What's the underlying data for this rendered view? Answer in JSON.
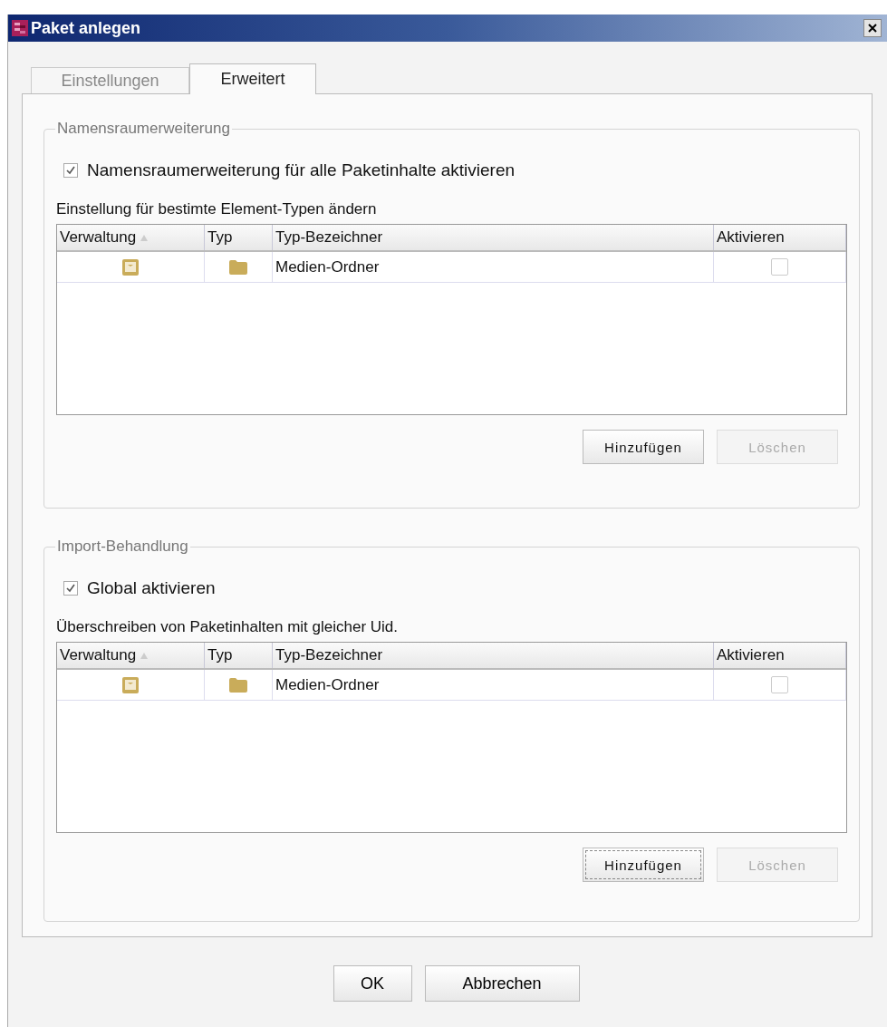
{
  "window": {
    "title": "Paket anlegen"
  },
  "tabs": [
    {
      "label": "Einstellungen",
      "selected": false
    },
    {
      "label": "Erweitert",
      "selected": true
    }
  ],
  "groups": [
    {
      "title": "Namensraumerweiterung",
      "checkbox": {
        "label": "Namensraumerweiterung für alle Paketinhalte aktivieren",
        "checked": true
      },
      "caption": "Einstellung für bestimte Element-Typen ändern",
      "table": {
        "columns": [
          "Verwaltung",
          "Typ",
          "Typ-Bezeichner",
          "Aktivieren"
        ],
        "rows": [
          {
            "type_label": "Medien-Ordner",
            "checked": false
          }
        ]
      },
      "buttons": [
        {
          "label": "Hinzufügen",
          "disabled": false,
          "focused": false
        },
        {
          "label": "Löschen",
          "disabled": true,
          "focused": false
        }
      ]
    },
    {
      "title": "Import-Behandlung",
      "checkbox": {
        "label": "Global aktivieren",
        "checked": true
      },
      "caption": "Überschreiben von Paketinhalten mit gleicher Uid.",
      "table": {
        "columns": [
          "Verwaltung",
          "Typ",
          "Typ-Bezeichner",
          "Aktivieren"
        ],
        "rows": [
          {
            "type_label": "Medien-Ordner",
            "checked": false
          }
        ]
      },
      "buttons": [
        {
          "label": "Hinzufügen",
          "disabled": false,
          "focused": true
        },
        {
          "label": "Löschen",
          "disabled": true,
          "focused": false
        }
      ]
    }
  ],
  "footer_buttons": [
    "OK",
    "Abbrechen"
  ]
}
